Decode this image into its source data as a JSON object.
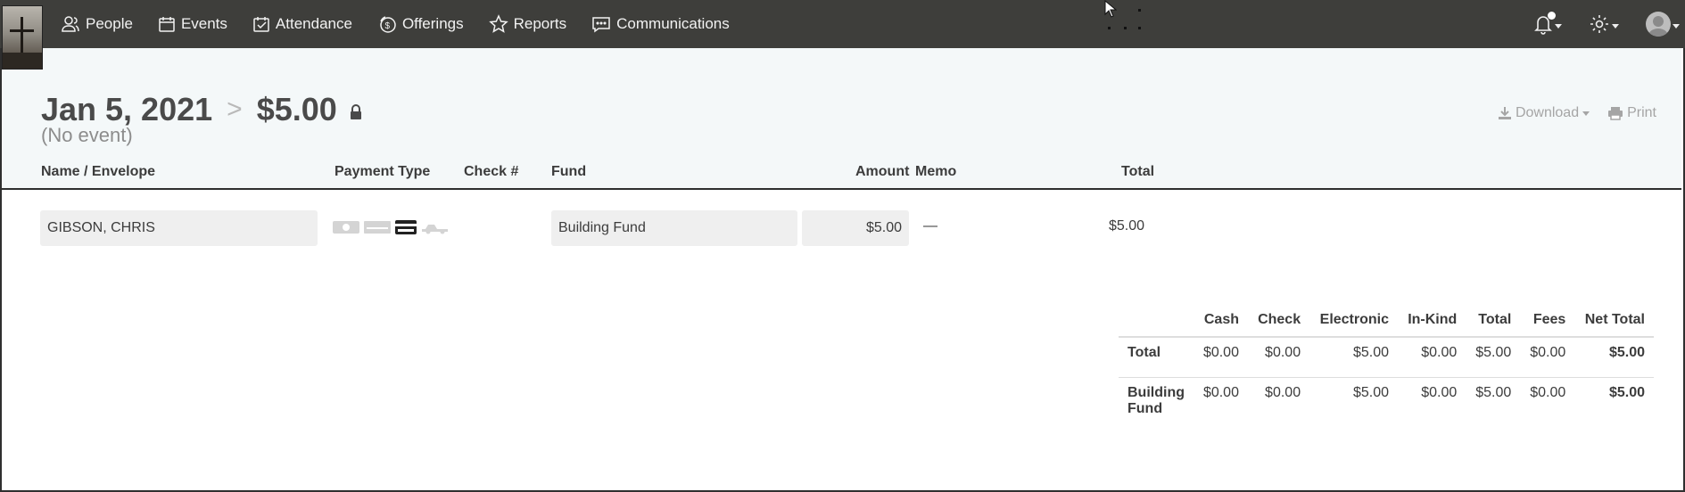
{
  "nav": {
    "items": [
      {
        "label": "People",
        "icon": "people-icon"
      },
      {
        "label": "Events",
        "icon": "calendar-icon"
      },
      {
        "label": "Attendance",
        "icon": "attendance-check-icon"
      },
      {
        "label": "Offerings",
        "icon": "offerings-coin-icon"
      },
      {
        "label": "Reports",
        "icon": "star-icon"
      },
      {
        "label": "Communications",
        "icon": "chat-icon"
      }
    ],
    "right_icons": [
      "bell-icon",
      "gear-icon",
      "user-avatar-icon"
    ]
  },
  "header": {
    "date": "Jan 5, 2021",
    "separator": ">",
    "amount": "$5.00",
    "subtitle": "(No event)",
    "download_label": "Download",
    "print_label": "Print"
  },
  "columns": {
    "name": "Name / Envelope",
    "payment_type": "Payment Type",
    "check": "Check #",
    "fund": "Fund",
    "amount": "Amount",
    "memo": "Memo",
    "total": "Total"
  },
  "row": {
    "name": "GIBSON, CHRIS",
    "payment_icons": [
      "cash-icon",
      "check-icon",
      "credit-card-icon",
      "in-kind-truck-icon"
    ],
    "selected_payment": "credit-card-icon",
    "fund": "Building Fund",
    "amount": "$5.00",
    "memo": "—",
    "total": "$5.00"
  },
  "summary": {
    "headers": [
      "",
      "Cash",
      "Check",
      "Electronic",
      "In-Kind",
      "Total",
      "Fees",
      "Net Total"
    ],
    "rows": [
      {
        "label": "Total",
        "cash": "$0.00",
        "check": "$0.00",
        "electronic": "$5.00",
        "inkind": "$0.00",
        "total": "$5.00",
        "fees": "$0.00",
        "net": "$5.00"
      },
      {
        "label": "Building Fund",
        "cash": "$0.00",
        "check": "$0.00",
        "electronic": "$5.00",
        "inkind": "$0.00",
        "total": "$5.00",
        "fees": "$0.00",
        "net": "$5.00"
      }
    ]
  },
  "colors": {
    "navbar": "#3e3e3b",
    "header_bg": "#f4f8f9",
    "text": "#3c3c3c",
    "muted": "#a5a5a5"
  }
}
